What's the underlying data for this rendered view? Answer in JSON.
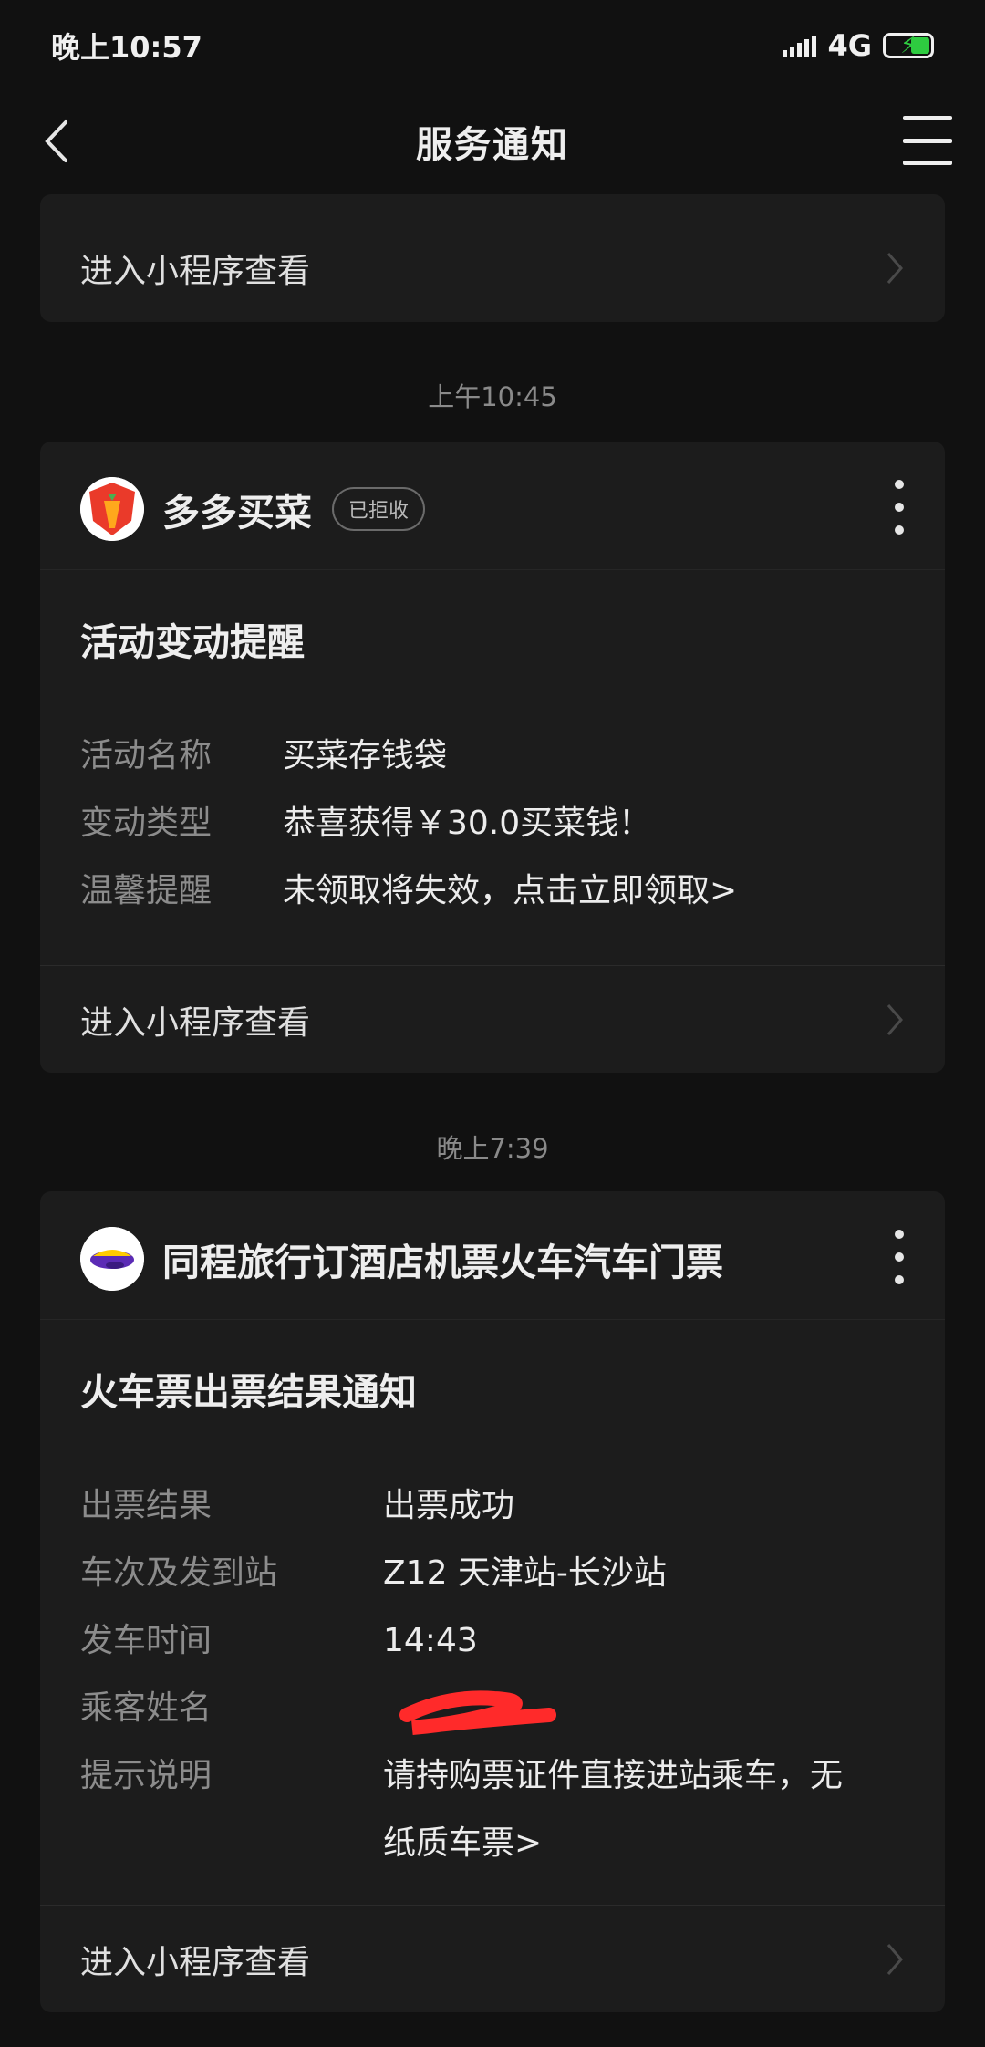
{
  "status_bar": {
    "time": "晚上10:57",
    "network": "4G"
  },
  "nav": {
    "title": "服务通知"
  },
  "top_card": {
    "footer_label": "进入小程序查看"
  },
  "messages": [
    {
      "time": "上午10:45",
      "app_name": "多多买菜",
      "badge": "已拒收",
      "title": "活动变动提醒",
      "fields": [
        {
          "key": "活动名称",
          "value": "买菜存钱袋"
        },
        {
          "key": "变动类型",
          "value": "恭喜获得￥30.0买菜钱！"
        },
        {
          "key": "温馨提醒",
          "value": "未领取将失效，点击立即领取>"
        }
      ],
      "footer_label": "进入小程序查看"
    },
    {
      "time": "晚上7:39",
      "app_name": "同程旅行订酒店机票火车汽车门票",
      "title": "火车票出票结果通知",
      "fields": [
        {
          "key": "出票结果",
          "value": "出票成功"
        },
        {
          "key": "车次及发到站",
          "value": "Z12 天津站-长沙站"
        },
        {
          "key": "发车时间",
          "value": "14:43"
        },
        {
          "key": "乘客姓名",
          "value": ""
        },
        {
          "key": "提示说明",
          "value_line1": "请持购票证件直接进站乘车，无",
          "value_line2": "纸质车票>"
        }
      ],
      "footer_label": "进入小程序查看"
    }
  ],
  "colors": {
    "redaction": "#ff2a2a",
    "background": "#111111",
    "card": "#1c1c1c"
  }
}
